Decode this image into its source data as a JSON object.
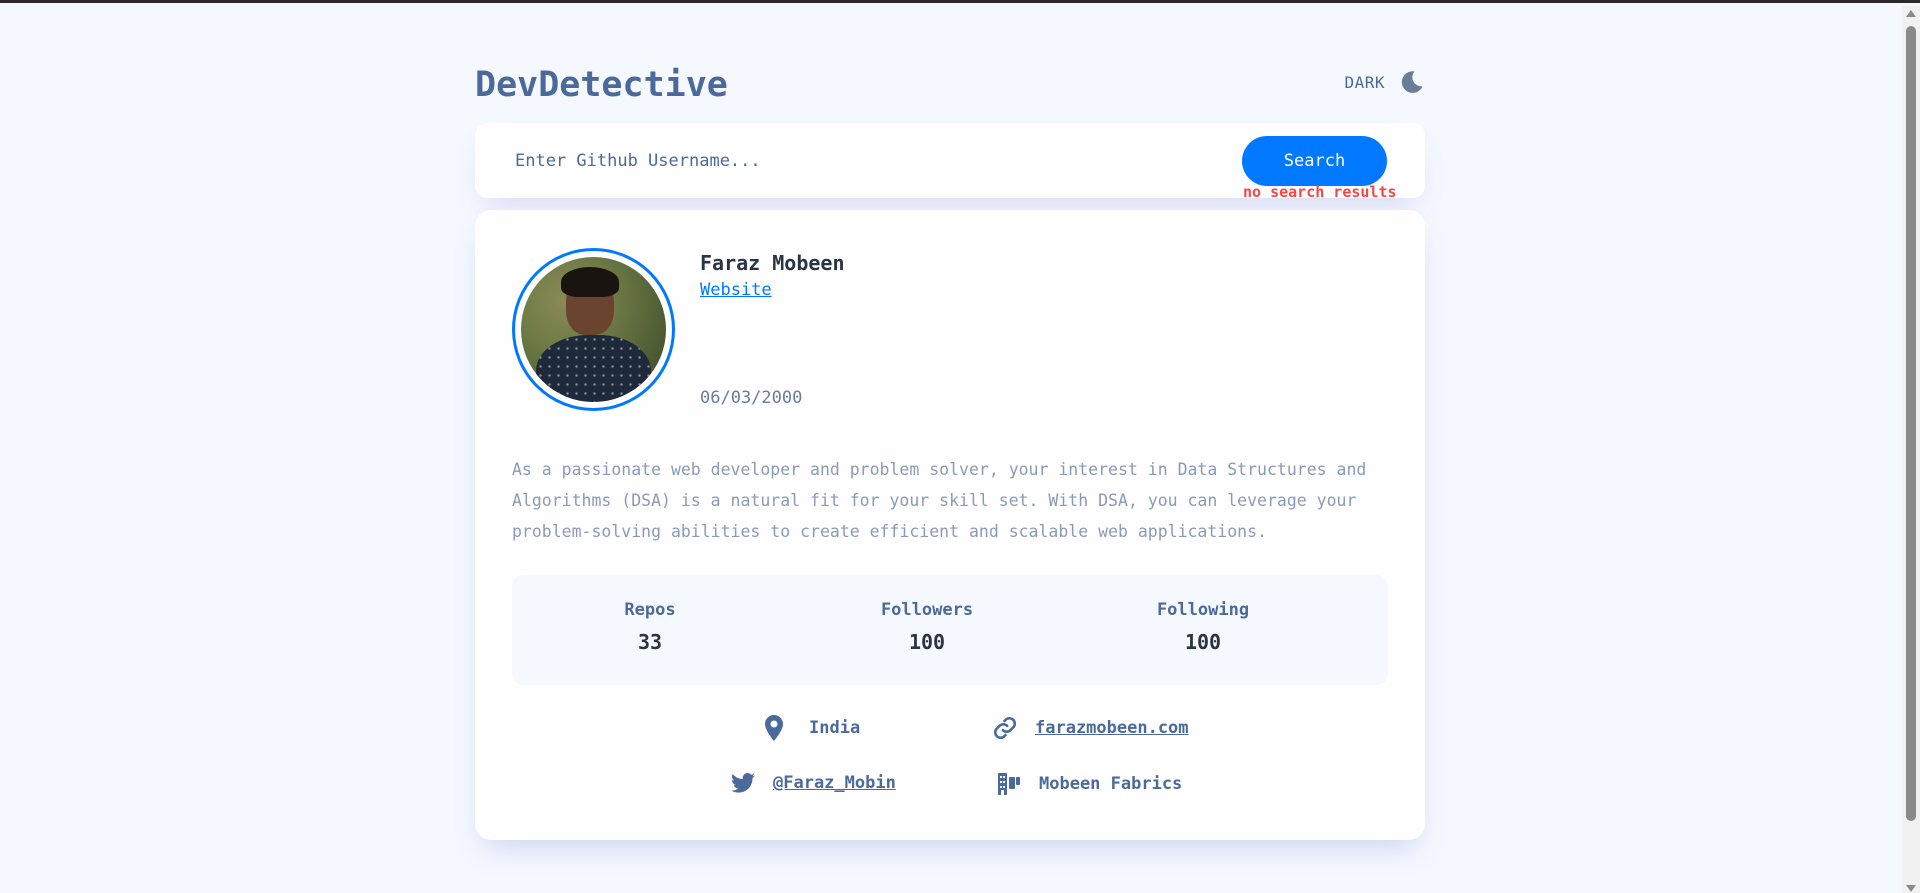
{
  "app": {
    "title": "DevDetective",
    "theme_label": "DARK"
  },
  "search": {
    "placeholder": "Enter Github Username...",
    "value": "",
    "button_label": "Search",
    "error": "no search results"
  },
  "profile": {
    "name": "Faraz Mobeen",
    "website_label": "Website",
    "joined": "06/03/2000",
    "bio": "As a passionate web developer and problem solver, your interest in Data Structures and Algorithms (DSA) is a natural fit for your skill set. With DSA, you can leverage your problem-solving abilities to create efficient and scalable web applications."
  },
  "stats": [
    {
      "label": "Repos",
      "value": "33"
    },
    {
      "label": "Followers",
      "value": "100"
    },
    {
      "label": "Following",
      "value": "100"
    }
  ],
  "info": {
    "location": "India",
    "blog": "farazmobeen.com",
    "twitter": "@Faraz_Mobin",
    "company": "Mobeen Fabrics"
  },
  "icons": {
    "theme": "moon-icon",
    "location": "map-pin-icon",
    "blog": "link-icon",
    "twitter": "twitter-icon",
    "company": "building-icon"
  },
  "colors": {
    "accent": "#0079ff",
    "error": "#f74646",
    "text_primary": "#2b3442",
    "text_secondary": "#4b6a9b",
    "background": "#f6f8ff"
  }
}
